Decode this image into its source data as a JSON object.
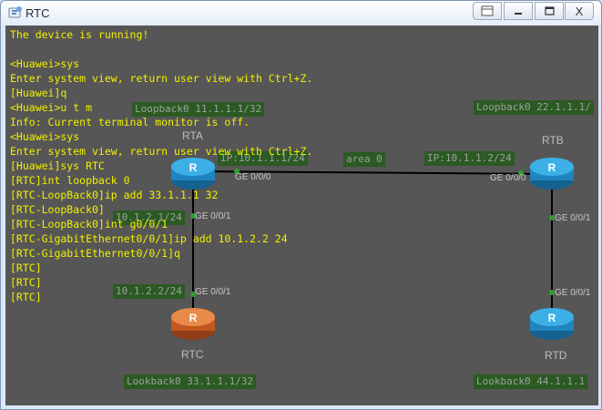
{
  "window": {
    "title": "RTC"
  },
  "controls": {
    "close_label": "X"
  },
  "topology": {
    "routers": [
      {
        "id": "rta",
        "name": "RTA",
        "kind": "router"
      },
      {
        "id": "rtb",
        "name": "RTB",
        "kind": "router"
      },
      {
        "id": "rtc",
        "name": "RTC",
        "kind": "router-selected"
      },
      {
        "id": "rtd",
        "name": "RTD",
        "kind": "router"
      }
    ],
    "tags": [
      "Loopback0 11.1.1.1/32",
      "Loopback0 22.1.1.1/",
      "IP:10.1.1.1/24",
      "area 0",
      "IP:10.1.1.2/24",
      "10.1.2.1/24",
      "10.1.2.2/24",
      "Lookback0 33.1.1.1/32",
      "Lookback0 44.1.1.1"
    ],
    "ports": [
      "GE 0/0/0",
      "GE 0/0/0",
      "GE 0/0/1",
      "GE 0/0/1",
      "GE 0/0/1",
      "GE 0/0/1"
    ],
    "colors": {
      "router_blue": "#2a9ed8",
      "router_orange": "#d7682e",
      "link": "#000000",
      "tag_bg": "#2b5a22"
    }
  },
  "terminal": {
    "lines": [
      "The device is running!",
      "",
      "<Huawei>sys",
      "Enter system view, return user view with Ctrl+Z.",
      "[Huawei]q",
      "<Huawei>u t m",
      "Info: Current terminal monitor is off.",
      "<Huawei>sys",
      "Enter system view, return user view with Ctrl+Z.",
      "[Huawei]sys RTC",
      "[RTC]int loopback 0",
      "[RTC-LoopBack0]ip add 33.1.1.1 32",
      "[RTC-LoopBack0]",
      "[RTC-LoopBack0]int g0/0/1",
      "[RTC-GigabitEthernet0/0/1]ip add 10.1.2.2 24",
      "[RTC-GigabitEthernet0/0/1]q",
      "[RTC]",
      "[RTC]",
      "[RTC]"
    ]
  }
}
